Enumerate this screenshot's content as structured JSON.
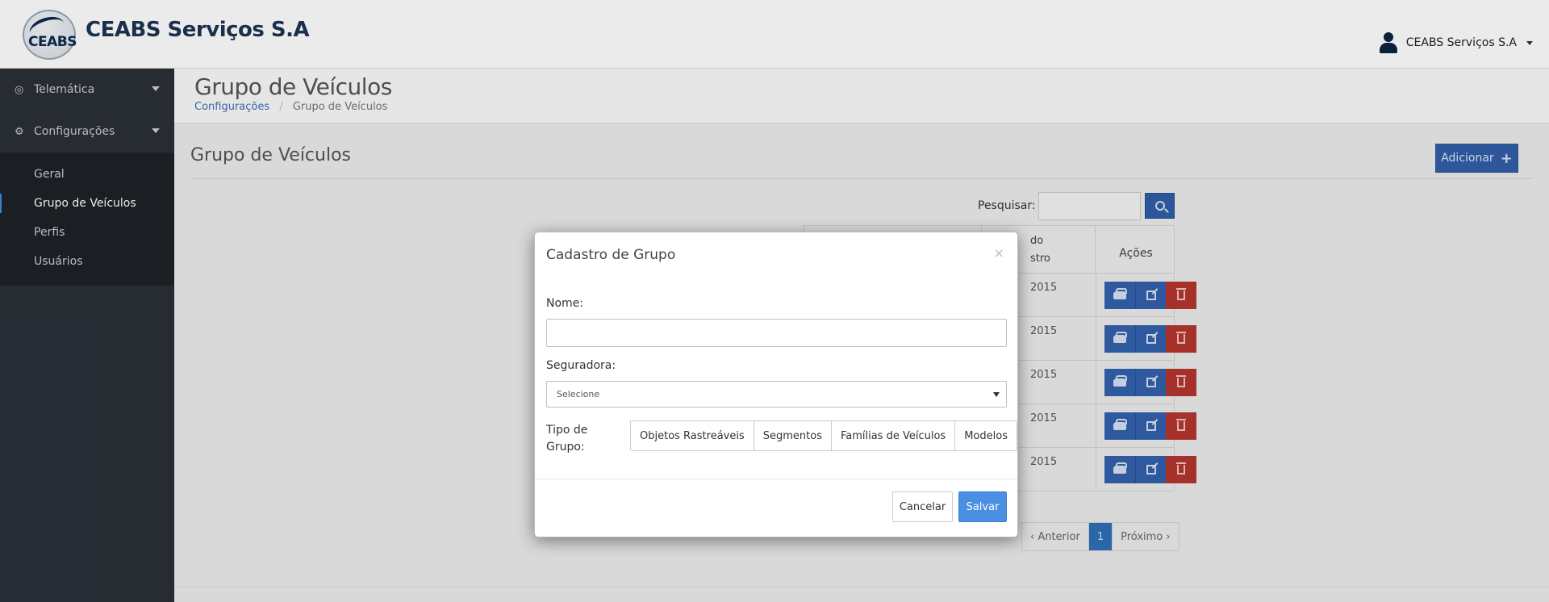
{
  "header": {
    "logo_text": "CEABS",
    "brand": "CEABS Serviços S.A",
    "user_name": "CEABS Serviços S.A"
  },
  "sidebar": {
    "groups": [
      {
        "label": "Telemática",
        "icon": "dashboard-icon"
      },
      {
        "label": "Configurações",
        "icon": "gears-icon"
      }
    ],
    "sub_items": [
      {
        "label": "Geral",
        "active": false
      },
      {
        "label": "Grupo de Veículos",
        "active": true
      },
      {
        "label": "Perfis",
        "active": false
      },
      {
        "label": "Usuários",
        "active": false
      }
    ]
  },
  "page": {
    "title": "Grupo de Veículos",
    "breadcrumb": {
      "parent": "Configurações",
      "current": "Grupo de Veículos"
    },
    "section_title": "Grupo de Veículos",
    "add_button": "Adicionar",
    "search_label": "Pesquisar:",
    "table": {
      "header_date": "do\nstro",
      "header_actions": "Ações",
      "rows": [
        {
          "date": "2015"
        },
        {
          "date": "2015"
        },
        {
          "date": "2015"
        },
        {
          "date": "2015"
        },
        {
          "date": "2015"
        }
      ]
    },
    "pager": {
      "prev": "‹ Anterior",
      "current": "1",
      "next": "Próximo ›"
    }
  },
  "modal": {
    "title": "Cadastro de Grupo",
    "close": "×",
    "nome_label": "Nome:",
    "nome_value": "",
    "seguradora_label": "Seguradora:",
    "seguradora_value": "Selecione",
    "tipo_label": "Tipo de Grupo:",
    "tipo_options": [
      "Objetos Rastreáveis",
      "Segmentos",
      "Famílias de Veículos",
      "Modelos"
    ],
    "cancel": "Cancelar",
    "save": "Salvar"
  },
  "colors": {
    "primary": "#325ea8",
    "danger": "#b5362e",
    "save": "#4b8fe3",
    "sidebar": "#2b3038"
  }
}
